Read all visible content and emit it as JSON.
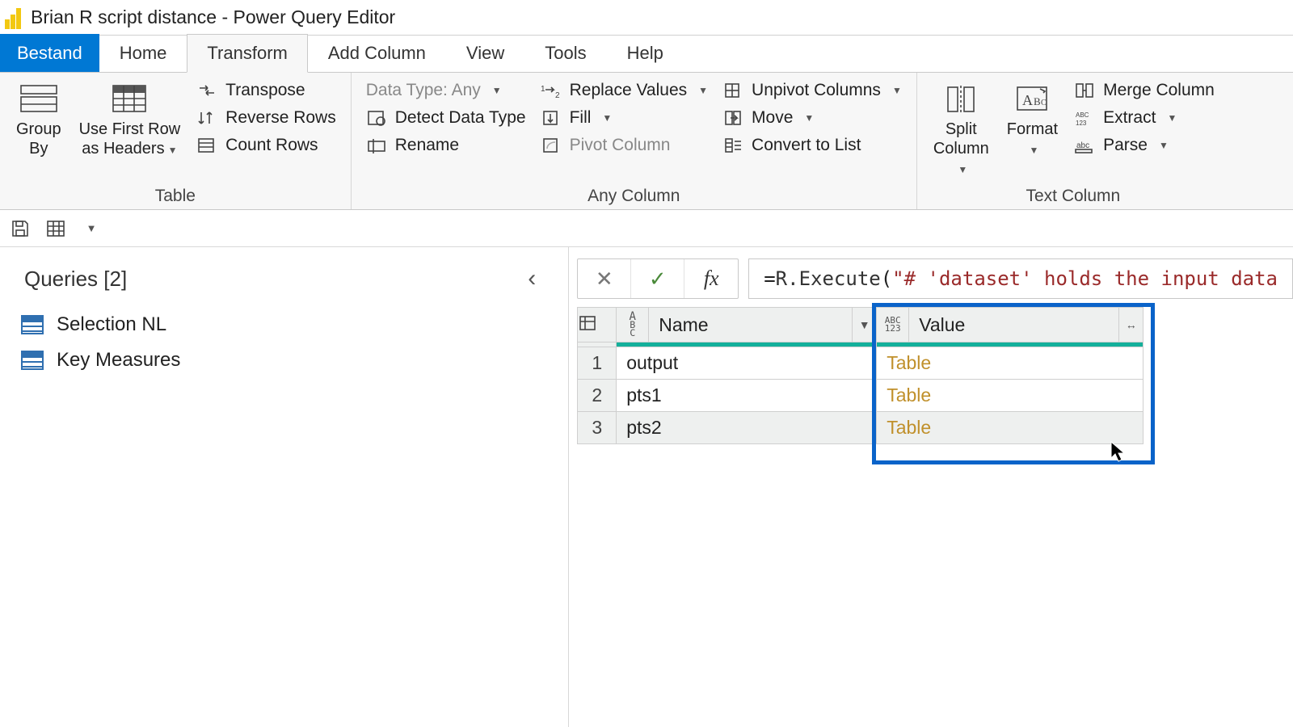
{
  "window": {
    "title": "Brian R script distance - Power Query Editor"
  },
  "tabs": {
    "file": "Bestand",
    "items": [
      "Home",
      "Transform",
      "Add Column",
      "View",
      "Tools",
      "Help"
    ],
    "active_index": 1
  },
  "ribbon": {
    "table": {
      "label": "Table",
      "group_by": "Group\nBy",
      "use_first_row": "Use First Row\nas Headers",
      "transpose": "Transpose",
      "reverse_rows": "Reverse Rows",
      "count_rows": "Count Rows"
    },
    "any_column": {
      "label": "Any Column",
      "data_type": "Data Type: Any",
      "detect": "Detect Data Type",
      "rename": "Rename",
      "replace": "Replace Values",
      "fill": "Fill",
      "pivot": "Pivot Column",
      "unpivot": "Unpivot Columns",
      "move": "Move",
      "convert": "Convert to List"
    },
    "text_column": {
      "label": "Text Column",
      "split": "Split\nColumn",
      "format": "Format",
      "merge": "Merge Column",
      "extract": "Extract",
      "parse": "Parse"
    }
  },
  "queries": {
    "header": "Queries [2]",
    "items": [
      {
        "name": "Selection NL",
        "selected": false
      },
      {
        "name": "Key Measures",
        "selected": false
      }
    ]
  },
  "formula": {
    "prefix": "= ",
    "fn": "R.Execute",
    "open": "(",
    "string": "\"# 'dataset' holds the input data"
  },
  "grid": {
    "columns": [
      {
        "name": "Name",
        "type": "text"
      },
      {
        "name": "Value",
        "type": "any"
      }
    ],
    "rows": [
      {
        "n": "1",
        "name": "output",
        "value": "Table"
      },
      {
        "n": "2",
        "name": "pts1",
        "value": "Table"
      },
      {
        "n": "3",
        "name": "pts2",
        "value": "Table"
      }
    ],
    "hover_row_index": 2
  },
  "colors": {
    "accent": "#0078d4",
    "highlight": "#0a63c9",
    "teal": "#14b09b",
    "link": "#c0902b"
  }
}
